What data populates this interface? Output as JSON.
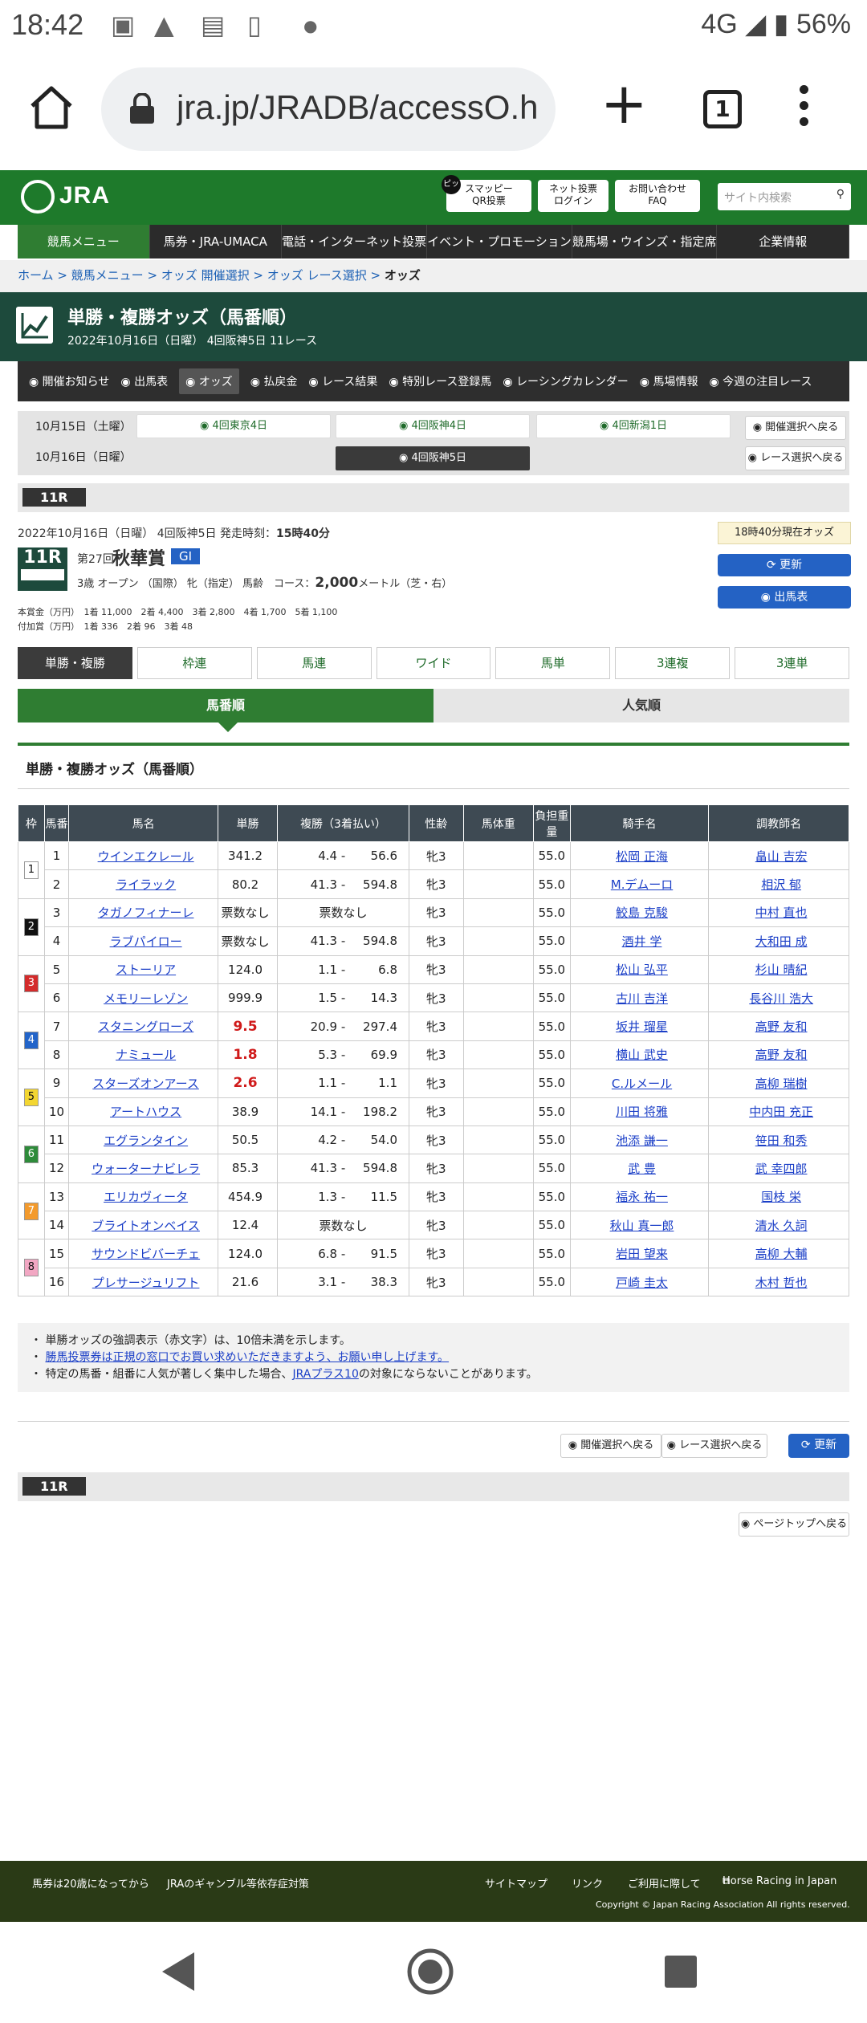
{
  "status": {
    "time": "18:42",
    "net": "4G",
    "battery": "56%"
  },
  "browser": {
    "url": "jra.jp/JRADB/accessO.h",
    "tab_count": "1"
  },
  "header": {
    "logo": "JRA",
    "btn1a": "スマッピー",
    "btn1b": "QR投票",
    "btn2a": "ネット投票",
    "btn2b": "ログイン",
    "btn3a": "お問い合わせ",
    "btn3b": "FAQ",
    "search_placeholder": "サイト内検索",
    "badge": "ピッ"
  },
  "nav1": [
    "競馬メニュー",
    "馬券・JRA-UMACA",
    "電話・インターネット投票",
    "イベント・プロモーション",
    "競馬場・ウインズ・指定席",
    "企業情報"
  ],
  "breadcrumb": [
    "ホーム",
    "競馬メニュー",
    "オッズ 開催選択",
    "オッズ レース選択",
    "オッズ"
  ],
  "title": {
    "main": "単勝・複勝オッズ（馬番順）",
    "sub": "2022年10月16日（日曜） 4回阪神5日 11レース"
  },
  "nav2": [
    "開催お知らせ",
    "出馬表",
    "オッズ",
    "払戻金",
    "レース結果",
    "特別レース登録馬",
    "レーシングカレンダー",
    "馬場情報",
    "今週の注目レース"
  ],
  "meetings": {
    "d1": "10月15日（土曜）",
    "d2": "10月16日（日曜）",
    "m1": "4回東京4日",
    "m2": "4回阪神4日",
    "m3": "4回新潟1日",
    "m4": "4回阪神5日",
    "back1": "開催選択へ戻る",
    "back2": "レース選択へ戻る"
  },
  "race": {
    "no": "11R",
    "date_line": "2022年10月16日（日曜） 4回阪神5日 発走時刻：",
    "start": "15時40分",
    "edition": "第27回",
    "name": "秋華賞",
    "grade": "GI",
    "cond": "3歳 オープン （国際） 牝（指定） 馬齢",
    "course": "コース：",
    "dist": "2,000",
    "unit": "メートル（芝・右）",
    "odds_time": "18時40分現在オッズ",
    "update": "更新",
    "entries": "出馬表",
    "prize_label": "本賞金（万円）",
    "prize": "1着 11,000　2着 4,400　3着 2,800　4着 1,700　5着 1,100",
    "add_label": "付加賞（万円）",
    "add": "1着 336　2着 96　3着 48"
  },
  "odds_tabs": [
    "単勝・複勝",
    "枠連",
    "馬連",
    "ワイド",
    "馬単",
    "3連複",
    "3連単"
  ],
  "order_tabs": [
    "馬番順",
    "人気順"
  ],
  "section": "単勝・複勝オッズ（馬番順）",
  "cols": [
    "枠",
    "馬番",
    "馬名",
    "単勝",
    "複勝（3着払い）",
    "性齢",
    "馬体重",
    "負担重量",
    "騎手名",
    "調教師名"
  ],
  "fuku_none": "票数なし",
  "horses": [
    {
      "w": "1",
      "n": "1",
      "name": "ウインエクレール",
      "win": "341.2",
      "fl": "4.4",
      "fh": "56.6",
      "sex": "牝3",
      "wt": "55.0",
      "jk": "松岡 正海",
      "tr": "畠山 吉宏"
    },
    {
      "w": "",
      "n": "2",
      "name": "ライラック",
      "win": "80.2",
      "fl": "41.3",
      "fh": "594.8",
      "sex": "牝3",
      "wt": "55.0",
      "jk": "M.デムーロ",
      "tr": "相沢 郁"
    },
    {
      "w": "2",
      "n": "3",
      "name": "タガノフィナーレ",
      "win": "票数なし",
      "fl": "",
      "fh": "",
      "sex": "牝3",
      "wt": "55.0",
      "jk": "鮫島 克駿",
      "tr": "中村 直也"
    },
    {
      "w": "",
      "n": "4",
      "name": "ラブパイロー",
      "win": "票数なし",
      "fl": "41.3",
      "fh": "594.8",
      "sex": "牝3",
      "wt": "55.0",
      "jk": "酒井 学",
      "tr": "大和田 成"
    },
    {
      "w": "3",
      "n": "5",
      "name": "ストーリア",
      "win": "124.0",
      "fl": "1.1",
      "fh": "6.8",
      "sex": "牝3",
      "wt": "55.0",
      "jk": "松山 弘平",
      "tr": "杉山 晴紀"
    },
    {
      "w": "",
      "n": "6",
      "name": "メモリーレゾン",
      "win": "999.9",
      "fl": "1.5",
      "fh": "14.3",
      "sex": "牝3",
      "wt": "55.0",
      "jk": "古川 吉洋",
      "tr": "長谷川 浩大"
    },
    {
      "w": "4",
      "n": "7",
      "name": "スタニングローズ",
      "win": "9.5",
      "fl": "20.9",
      "fh": "297.4",
      "sex": "牝3",
      "wt": "55.0",
      "jk": "坂井 瑠星",
      "tr": "高野 友和"
    },
    {
      "w": "",
      "n": "8",
      "name": "ナミュール",
      "win": "1.8",
      "fl": "5.3",
      "fh": "69.9",
      "sex": "牝3",
      "wt": "55.0",
      "jk": "横山 武史",
      "tr": "高野 友和"
    },
    {
      "w": "5",
      "n": "9",
      "name": "スターズオンアース",
      "win": "2.6",
      "fl": "1.1",
      "fh": "1.1",
      "sex": "牝3",
      "wt": "55.0",
      "jk": "C.ルメール",
      "tr": "高柳 瑞樹"
    },
    {
      "w": "",
      "n": "10",
      "name": "アートハウス",
      "win": "38.9",
      "fl": "14.1",
      "fh": "198.2",
      "sex": "牝3",
      "wt": "55.0",
      "jk": "川田 将雅",
      "tr": "中内田 充正"
    },
    {
      "w": "6",
      "n": "11",
      "name": "エグランタイン",
      "win": "50.5",
      "fl": "4.2",
      "fh": "54.0",
      "sex": "牝3",
      "wt": "55.0",
      "jk": "池添 謙一",
      "tr": "笹田 和秀"
    },
    {
      "w": "",
      "n": "12",
      "name": "ウォーターナビレラ",
      "win": "85.3",
      "fl": "41.3",
      "fh": "594.8",
      "sex": "牝3",
      "wt": "55.0",
      "jk": "武 豊",
      "tr": "武 幸四郎"
    },
    {
      "w": "7",
      "n": "13",
      "name": "エリカヴィータ",
      "win": "454.9",
      "fl": "1.3",
      "fh": "11.5",
      "sex": "牝3",
      "wt": "55.0",
      "jk": "福永 祐一",
      "tr": "国枝 栄"
    },
    {
      "w": "",
      "n": "14",
      "name": "ブライトオンベイス",
      "win": "12.4",
      "fl": "",
      "fh": "",
      "sex": "牝3",
      "wt": "55.0",
      "jk": "秋山 真一郎",
      "tr": "清水 久詞"
    },
    {
      "w": "8",
      "n": "15",
      "name": "サウンドビバーチェ",
      "win": "124.0",
      "fl": "6.8",
      "fh": "91.5",
      "sex": "牝3",
      "wt": "55.0",
      "jk": "岩田 望来",
      "tr": "高柳 大輔"
    },
    {
      "w": "",
      "n": "16",
      "name": "プレサージュリフト",
      "win": "21.6",
      "fl": "3.1",
      "fh": "38.3",
      "sex": "牝3",
      "wt": "55.0",
      "jk": "戸崎 圭太",
      "tr": "木村 哲也"
    }
  ],
  "waku_colors": {
    "1": "#ffffff",
    "2": "#111111",
    "3": "#d42b2b",
    "4": "#2264c9",
    "5": "#f3d631",
    "6": "#2e8b3a",
    "7": "#f39a2c",
    "8": "#f2a7c3"
  },
  "notes": [
    "単勝オッズの強調表示（赤文字）は、10倍未満を示します。",
    "勝馬投票券は正規の窓口でお買い求めいただきますよう、お願い申し上げます。",
    "特定の馬番・組番に人気が著しく集中した場合、",
    "JRAプラス10",
    "の対象にならないことがあります。"
  ],
  "bottom": {
    "b1": "開催選択へ戻る",
    "b2": "レース選択へ戻る",
    "b3": "更新",
    "pagetop": "ページトップへ戻る"
  },
  "footer": {
    "f1": "馬券は20歳になってから",
    "f2": "JRAのギャンブル等依存症対策",
    "f3": "サイトマップ",
    "f4": "リンク",
    "f5": "ご利用に際して",
    "f6": "Horse Racing in Japan",
    "copy": "Copyright © Japan Racing Association All rights reserved."
  }
}
